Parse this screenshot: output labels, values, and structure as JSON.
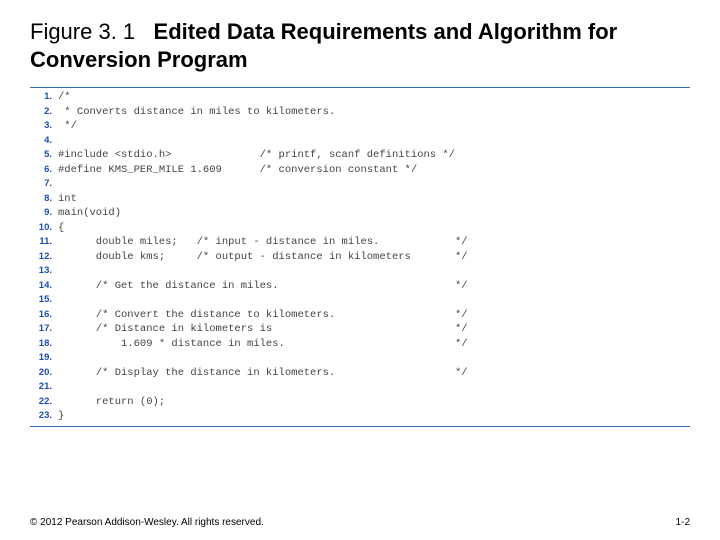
{
  "title": {
    "prefix": "Figure 3. 1",
    "main": "Edited Data Requirements and Algorithm for Conversion Program"
  },
  "code": {
    "lines": [
      {
        "n": "1.",
        "t": "/*"
      },
      {
        "n": "2.",
        "t": " * Converts distance in miles to kilometers."
      },
      {
        "n": "3.",
        "t": " */"
      },
      {
        "n": "4.",
        "t": ""
      },
      {
        "n": "5.",
        "t": "#include <stdio.h>              /* printf, scanf definitions */"
      },
      {
        "n": "6.",
        "t": "#define KMS_PER_MILE 1.609      /* conversion constant */"
      },
      {
        "n": "7.",
        "t": ""
      },
      {
        "n": "8.",
        "t": "int"
      },
      {
        "n": "9.",
        "t": "main(void)"
      },
      {
        "n": "10.",
        "t": "{"
      },
      {
        "n": "11.",
        "t": "      double miles;   /* input - distance in miles.            */"
      },
      {
        "n": "12.",
        "t": "      double kms;     /* output - distance in kilometers       */"
      },
      {
        "n": "13.",
        "t": ""
      },
      {
        "n": "14.",
        "t": "      /* Get the distance in miles.                            */"
      },
      {
        "n": "15.",
        "t": ""
      },
      {
        "n": "16.",
        "t": "      /* Convert the distance to kilometers.                   */"
      },
      {
        "n": "17.",
        "t": "      /* Distance in kilometers is                             */"
      },
      {
        "n": "18.",
        "t": "          1.609 * distance in miles.                           */"
      },
      {
        "n": "19.",
        "t": ""
      },
      {
        "n": "20.",
        "t": "      /* Display the distance in kilometers.                   */"
      },
      {
        "n": "21.",
        "t": ""
      },
      {
        "n": "22.",
        "t": "      return (0);"
      },
      {
        "n": "23.",
        "t": "}"
      }
    ]
  },
  "footer": {
    "copyright": "© 2012 Pearson Addison-Wesley. All rights reserved.",
    "page": "1-2"
  }
}
